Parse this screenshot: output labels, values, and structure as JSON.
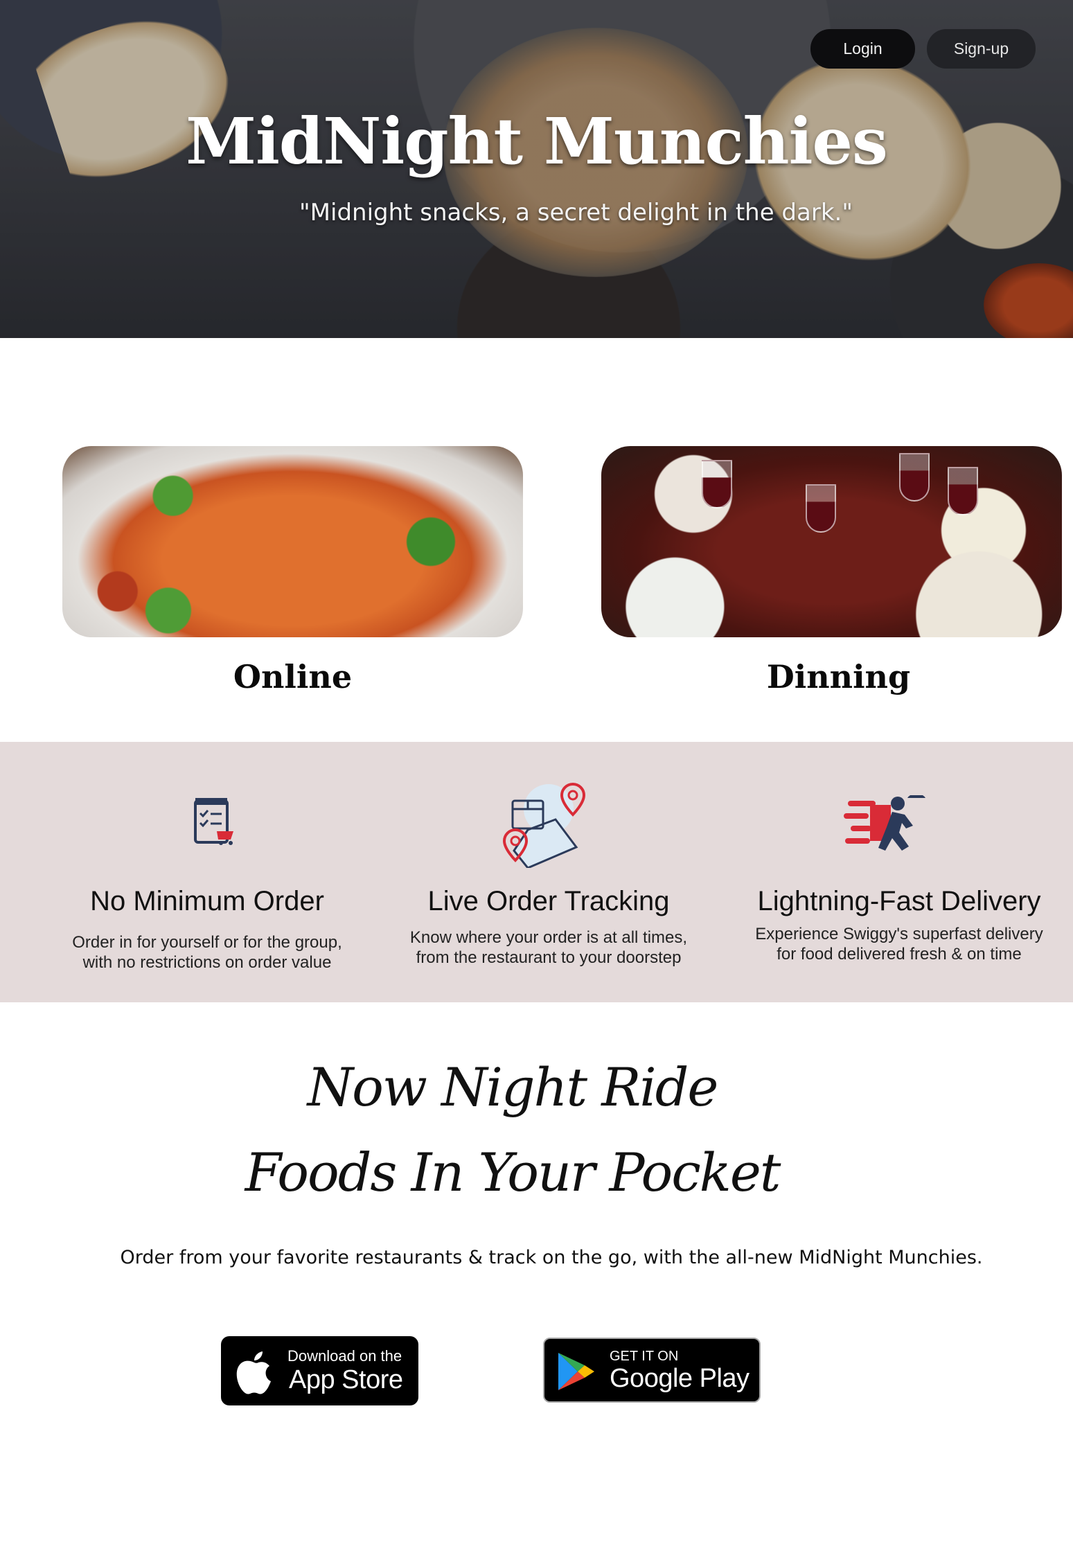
{
  "header": {
    "login_label": "Login",
    "signup_label": "Sign-up",
    "title": "MidNight Munchies",
    "tagline": "\"Midnight snacks, a secret delight in the dark.\""
  },
  "categories": [
    {
      "label": "Online"
    },
    {
      "label": "Dinning"
    }
  ],
  "features": [
    {
      "icon": "order-checklist-icon",
      "title": "No Minimum Order",
      "desc_line1": "Order in for yourself or for the group,",
      "desc_line2": "with no restrictions on order value"
    },
    {
      "icon": "order-tracking-icon",
      "title": "Live Order Tracking",
      "desc_line1": "Know where your order is at all times,",
      "desc_line2": "from the restaurant to your doorstep"
    },
    {
      "icon": "fast-delivery-icon",
      "title": "Lightning-Fast Delivery",
      "desc_line1": "Experience Swiggy's superfast delivery",
      "desc_line2": "for food delivered fresh & on time"
    }
  ],
  "promo": {
    "line1": "Now Night Ride",
    "line2": "Foods In Your Pocket",
    "description": "Order from your favorite restaurants & track on the go, with the all-new  MidNight Munchies."
  },
  "stores": {
    "appstore_small": "Download on the",
    "appstore_big": "App Store",
    "gplay_small": "GET IT ON",
    "gplay_big": "Google Play"
  },
  "colors": {
    "feature_band": "#e4dada",
    "icon_red": "#d92b37",
    "icon_navy": "#2b3a5a"
  }
}
